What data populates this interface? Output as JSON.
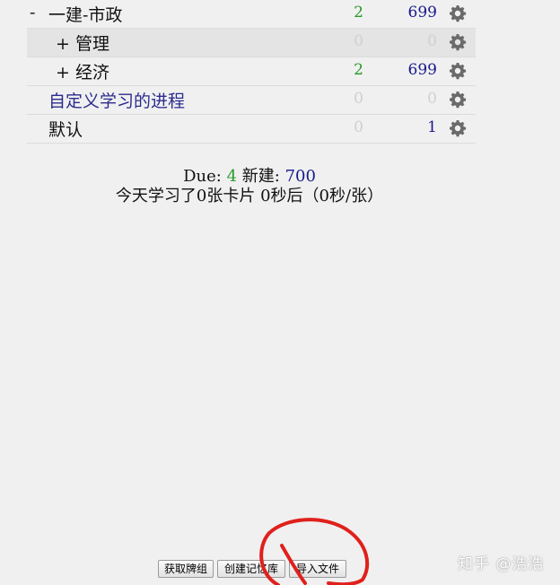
{
  "decks": [
    {
      "toggle": "-",
      "name": "一建-市政",
      "due": "2",
      "new": "699",
      "highlight": false,
      "link": false
    },
    {
      "toggle": "",
      "name": "+ 管理",
      "due": "0",
      "new": "0",
      "highlight": true,
      "link": false
    },
    {
      "toggle": "",
      "name": "+ 经济",
      "due": "2",
      "new": "699",
      "highlight": false,
      "link": false
    },
    {
      "toggle": "",
      "name": "自定义学习的进程",
      "due": "0",
      "new": "0",
      "highlight": false,
      "link": true
    },
    {
      "toggle": "",
      "name": "默认",
      "due": "0",
      "new": "1",
      "highlight": false,
      "link": false
    }
  ],
  "summary": {
    "due_label": "Due:",
    "due_value": "4",
    "new_label": "新建:",
    "new_value": "700",
    "studied_prefix": "今天学习了",
    "studied_cards": "0",
    "studied_cards_unit": "张卡片",
    "studied_time": "0",
    "studied_time_unit": "秒后（0秒/张）"
  },
  "buttons": {
    "get_shared": "获取牌组",
    "create_deck": "创建记忆库",
    "import_file": "导入文件"
  },
  "watermark": "知乎 @浩浩",
  "colors": {
    "due_green": "#2a9a2a",
    "new_blue": "#1a1a8c",
    "zero_gray": "#d0d0d0",
    "annotation_red": "#e0201c"
  }
}
